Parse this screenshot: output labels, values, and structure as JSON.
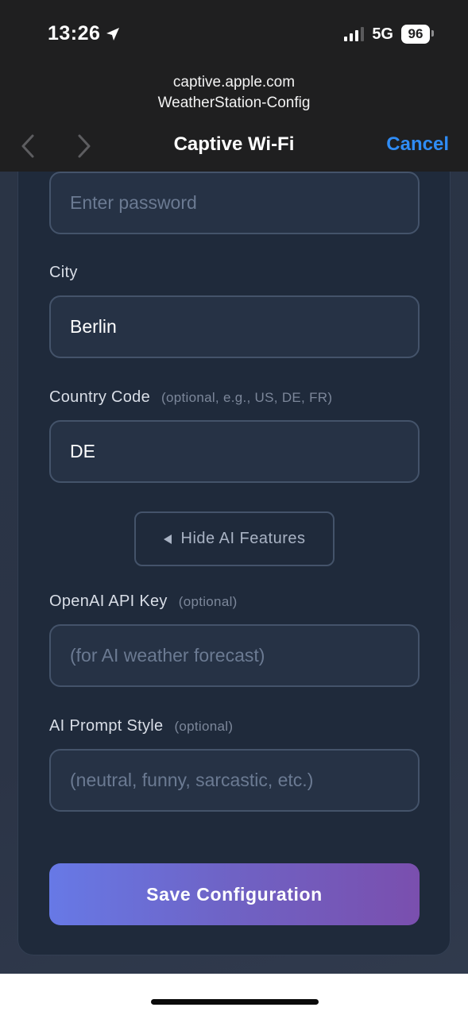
{
  "status_bar": {
    "time": "13:26",
    "network": "5G",
    "battery": "96",
    "location_icon": "location-arrow-icon",
    "signal_icon": "cellular-signal-icon"
  },
  "browser": {
    "domain": "captive.apple.com",
    "ssid": "WeatherStation-Config",
    "title": "Captive Wi-Fi",
    "cancel_label": "Cancel",
    "back_icon": "chevron-left-icon",
    "forward_icon": "chevron-right-icon",
    "accent_color": "#2f8cf5"
  },
  "form": {
    "password": {
      "placeholder": "Enter password"
    },
    "city": {
      "label": "City",
      "value": "Berlin"
    },
    "country_code": {
      "label": "Country Code",
      "hint": "(optional, e.g., US, DE, FR)",
      "value": "DE"
    },
    "toggle_ai": {
      "label": "Hide AI Features",
      "icon": "triangle-left-icon"
    },
    "openai_key": {
      "label": "OpenAI API Key",
      "hint": "(optional)",
      "placeholder": "(for AI weather forecast)"
    },
    "prompt_style": {
      "label": "AI Prompt Style",
      "hint": "(optional)",
      "placeholder": "(neutral, funny, sarcastic, etc.)"
    },
    "save_label": "Save Configuration"
  },
  "colors": {
    "header_bg": "#1f1f20",
    "card_bg": "#1f2a3b",
    "button_gradient_start": "#6779e6",
    "button_gradient_end": "#7a4fae"
  }
}
